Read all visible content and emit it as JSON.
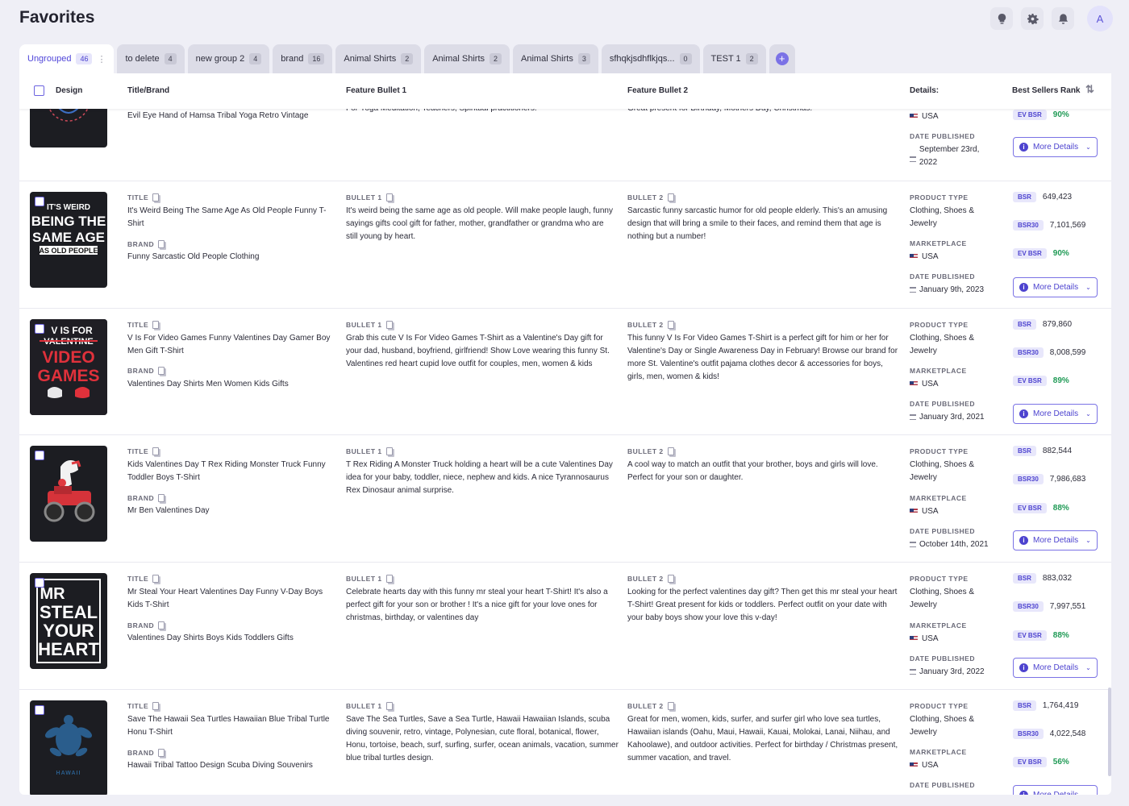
{
  "header": {
    "title": "Favorites",
    "avatar_initial": "A",
    "icons": [
      "lightbulb-icon",
      "gear-icon",
      "bell-icon"
    ]
  },
  "tabs": [
    {
      "label": "Ungrouped",
      "count": "46",
      "active": true
    },
    {
      "label": "to delete",
      "count": "4"
    },
    {
      "label": "new group 2",
      "count": "4"
    },
    {
      "label": "brand",
      "count": "16"
    },
    {
      "label": "Animal Shirts",
      "count": "2"
    },
    {
      "label": "Animal Shirts",
      "count": "2"
    },
    {
      "label": "Animal Shirts",
      "count": "3"
    },
    {
      "label": "sfhqkjsdhflkjqs...",
      "count": "0"
    },
    {
      "label": "TEST 1",
      "count": "2"
    }
  ],
  "columns": {
    "design": "Design",
    "title_brand": "Title/Brand",
    "bullet1": "Feature Bullet 1",
    "bullet2": "Feature Bullet 2",
    "details": "Details:",
    "bsr": "Best Sellers Rank"
  },
  "labels": {
    "title": "TITLE",
    "brand": "BRAND",
    "bullet1": "BULLET 1",
    "bullet2": "BULLET 2",
    "product_type": "PRODUCT TYPE",
    "marketplace": "MARKETPLACE",
    "date_published": "DATE PUBLISHED",
    "bsr": "BSR",
    "bsr30": "BSR30",
    "ev_bsr": "EV BSR",
    "more_details": "More Details"
  },
  "rows": [
    {
      "title": "Evil Eye Hand of Hamsa Tribal Yoga Retro Vintage",
      "bullet1": "For Yoga Meditation, Teachers, Spiritual practitioners.",
      "bullet2": "Great present for Birthday, Mothers Day, Christmas.",
      "marketplace": "USA",
      "date": "September 23rd, 2022",
      "ev_bsr": "90%"
    },
    {
      "title": "It's Weird Being The Same Age As Old People Funny T-Shirt",
      "brand": "Funny Sarcastic Old People Clothing",
      "bullet1": "It's weird being the same age as old people. Will make people laugh, funny sayings gifts cool gift for father, mother, grandfather or grandma who are still young by heart.",
      "bullet2": "Sarcastic funny sarcastic humor for old people elderly. This's an amusing design that will bring a smile to their faces, and remind them that age is nothing but a number!",
      "product_type": "Clothing, Shoes & Jewelry",
      "marketplace": "USA",
      "date": "January 9th, 2023",
      "bsr": "649,423",
      "bsr30": "7,101,569",
      "ev_bsr": "90%"
    },
    {
      "title": "V Is For Video Games Funny Valentines Day Gamer Boy Men Gift T-Shirt",
      "brand": "Valentines Day Shirts Men Women Kids Gifts",
      "bullet1": "Grab this cute V Is For Video Games T-Shirt as a Valentine's Day gift for your dad, husband, boyfriend, girlfriend! Show Love wearing this funny St. Valentines red heart cupid love outfit for couples, men, women & kids",
      "bullet2": "This funny V Is For Video Games T-Shirt is a perfect gift for him or her for Valentine's Day or Single Awareness Day in February! Browse our brand for more St. Valentine's outfit pajama clothes decor & accessories for boys, girls, men, women & kids!",
      "product_type": "Clothing, Shoes & Jewelry",
      "marketplace": "USA",
      "date": "January 3rd, 2021",
      "bsr": "879,860",
      "bsr30": "8,008,599",
      "ev_bsr": "89%"
    },
    {
      "title": "Kids Valentines Day T Rex Riding Monster Truck Funny Toddler Boys T-Shirt",
      "brand": "Mr Ben Valentines Day",
      "bullet1": "T Rex Riding A Monster Truck holding a heart will be a cute Valentines Day idea for your baby, toddler, niece, nephew and kids. A nice Tyrannosaurus Rex Dinosaur animal surprise.",
      "bullet2": "A cool way to match an outfit that your brother, boys and girls will love. Perfect for your son or daughter.",
      "product_type": "Clothing, Shoes & Jewelry",
      "marketplace": "USA",
      "date": "October 14th, 2021",
      "bsr": "882,544",
      "bsr30": "7,986,683",
      "ev_bsr": "88%"
    },
    {
      "title": "Mr Steal Your Heart Valentines Day Funny V-Day Boys Kids T-Shirt",
      "brand": "Valentines Day Shirts Boys Kids Toddlers Gifts",
      "bullet1": "Celebrate hearts day with this funny mr steal your heart T-Shirt! It's also a perfect gift for your son or brother ! It's a nice gift for your love ones for christmas, birthday, or valentines day",
      "bullet2": "Looking for the perfect valentines day gift? Then get this mr steal your heart T-Shirt! Great present for kids or toddlers. Perfect outfit on your date with your baby boys show your love this v-day!",
      "product_type": "Clothing, Shoes & Jewelry",
      "marketplace": "USA",
      "date": "January 3rd, 2022",
      "bsr": "883,032",
      "bsr30": "7,997,551",
      "ev_bsr": "88%"
    },
    {
      "title": "Save The Hawaii Sea Turtles Hawaiian Blue Tribal Turtle Honu T-Shirt",
      "brand": "Hawaii Tribal Tattoo Design Scuba Diving Souvenirs",
      "bullet1": "Save The Sea Turtles, Save a Sea Turtle, Hawaii Hawaiian Islands, scuba diving souvenir, retro, vintage, Polynesian, cute floral, botanical, flower, Honu, tortoise, beach, surf, surfing, surfer, ocean animals, vacation, summer blue tribal turtles design.",
      "bullet2": "Great for men, women, kids, surfer, and surfer girl who love sea turtles, Hawaiian islands (Oahu, Maui, Hawaii, Kauai, Molokai, Lanai, Niihau, and Kahoolawe), and outdoor activities. Perfect for birthday / Christmas present, summer vacation, and travel.",
      "product_type": "Clothing, Shoes & Jewelry",
      "marketplace": "USA",
      "bsr": "1,764,419",
      "bsr30": "4,022,548",
      "ev_bsr": "56%"
    }
  ],
  "designs": {
    "d2": {
      "lines": [
        "IT'S WEIRD",
        "BEING THE",
        "SAME AGE",
        "AS OLD PEOPLE"
      ]
    },
    "d3": {
      "lines": [
        "V IS FOR",
        "VALENTINE",
        "VIDEO",
        "GAMES"
      ]
    },
    "d5": {
      "lines": [
        "MR",
        "STEAL",
        "YOUR",
        "HEART"
      ]
    },
    "d6": {
      "lines": [
        "HAWAII"
      ]
    }
  }
}
